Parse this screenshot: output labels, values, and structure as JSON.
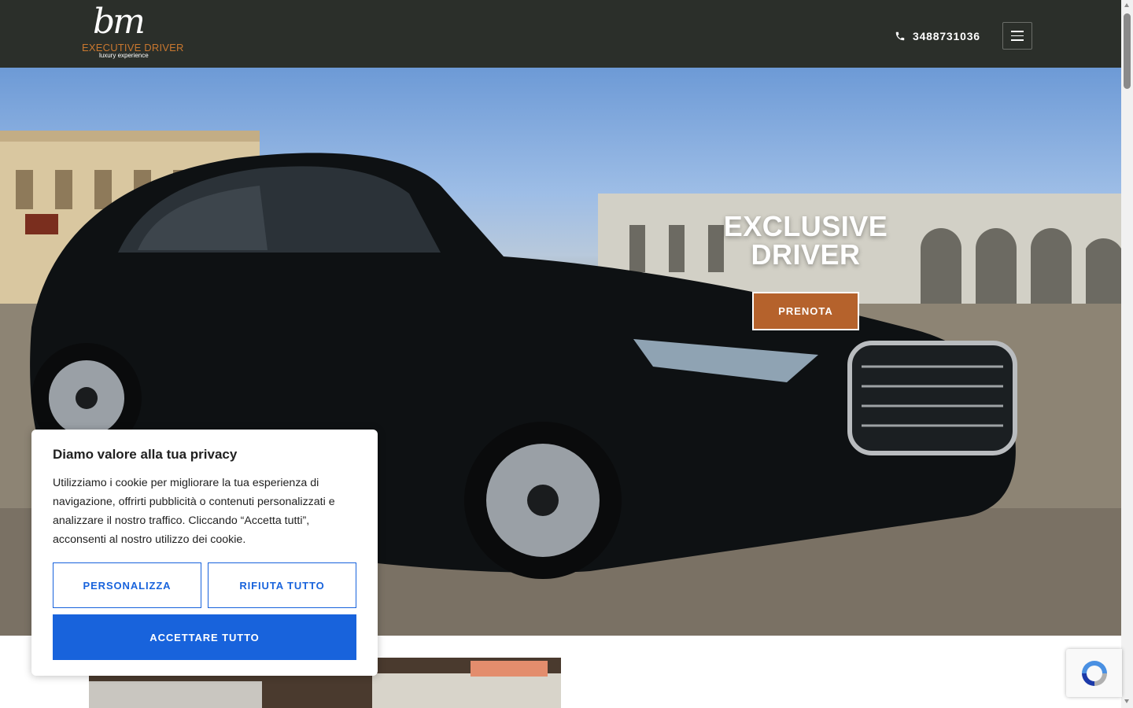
{
  "header": {
    "logo": {
      "script": "bm",
      "title": "EXECUTIVE DRIVER",
      "subtitle": "luxury experience"
    },
    "phone": "3488731036",
    "menu_icon": "hamburger-icon"
  },
  "hero": {
    "title": "EXCLUSIVE DRIVER",
    "cta_label": "PRENOTA"
  },
  "cookie_banner": {
    "title": "Diamo valore alla tua privacy",
    "text": "Utilizziamo i cookie per migliorare la tua esperienza di navigazione, offrirti pubblicità o contenuti personalizzati e analizzare il nostro traffico. Cliccando “Accetta tutti”, acconsenti al nostro utilizzo dei cookie.",
    "customize_label": "PERSONALIZZA",
    "reject_label": "RIFIUTA TUTTO",
    "accept_label": "ACCETTARE TUTTO"
  },
  "colors": {
    "header_bg": "#2b2f2a",
    "accent": "#b5622c",
    "cookie_primary": "#1863dc"
  }
}
